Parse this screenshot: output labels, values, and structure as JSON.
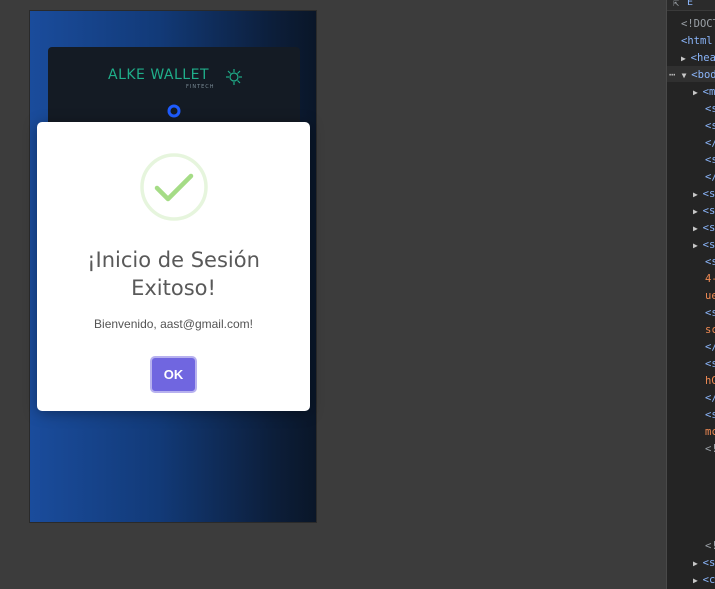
{
  "app": {
    "logo_text": "ALKE WALLET",
    "logo_sub": "FINTECH"
  },
  "modal": {
    "icon": "checkmark-success-icon",
    "title": "¡Inicio de Sesión Exitoso!",
    "message": "Bienvenido, aast@gmail.com!",
    "ok_label": "OK"
  },
  "devtools": {
    "toolbar_text": "E",
    "lines": [
      {
        "text": "<!DOCT",
        "cls": "grey"
      },
      {
        "text": "<html",
        "cls": "tag"
      },
      {
        "text": "<hea",
        "cls": "tag"
      },
      {
        "text": "<bod",
        "cls": "tag"
      },
      {
        "text": "<m",
        "cls": "tag"
      },
      {
        "text": "<s",
        "cls": "tag"
      },
      {
        "text": "<s",
        "cls": "tag"
      },
      {
        "text": "</",
        "cls": "tag"
      },
      {
        "text": "<s",
        "cls": "tag"
      },
      {
        "text": "</",
        "cls": "tag"
      },
      {
        "text": "<s",
        "cls": "tag"
      },
      {
        "text": "<s",
        "cls": "tag"
      },
      {
        "text": "<s",
        "cls": "tag"
      },
      {
        "text": "<s",
        "cls": "tag"
      },
      {
        "text": "<s",
        "cls": "tag"
      },
      {
        "text": "4-",
        "cls": "orange"
      },
      {
        "text": "ue",
        "cls": "orange"
      },
      {
        "text": "<s",
        "cls": "tag"
      },
      {
        "text": "sc",
        "cls": "orange"
      },
      {
        "text": "</",
        "cls": "tag"
      },
      {
        "text": "<s",
        "cls": "tag"
      },
      {
        "text": "hG",
        "cls": "orange"
      },
      {
        "text": "</",
        "cls": "tag"
      },
      {
        "text": "<s",
        "cls": "tag"
      },
      {
        "text": "mc",
        "cls": "orange"
      },
      {
        "text": "<!",
        "cls": "grey"
      },
      {
        "text": "<!",
        "cls": "grey"
      },
      {
        "text": "<s",
        "cls": "tag"
      },
      {
        "text": "<c",
        "cls": "tag"
      }
    ]
  },
  "colors": {
    "confirm_button": "#7066e0",
    "success_green": "#a5dc86",
    "brand_teal": "#1fae8a"
  }
}
